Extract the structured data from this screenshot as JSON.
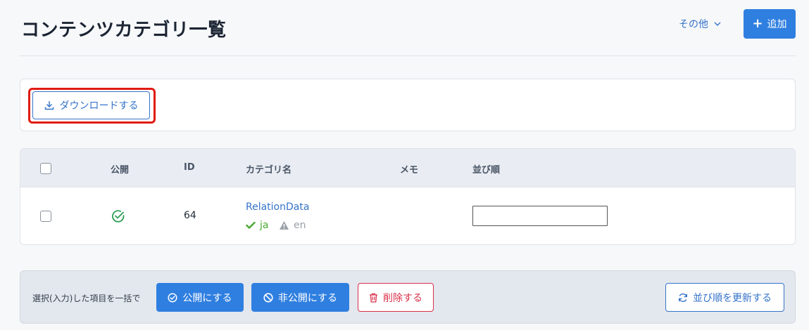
{
  "header": {
    "title": "コンテンツカテゴリ一覧",
    "other_label": "その他",
    "add_label": "追加"
  },
  "download": {
    "label": "ダウンロードする"
  },
  "table": {
    "columns": {
      "published": "公開",
      "id": "ID",
      "category_name": "カテゴリ名",
      "memo": "メモ",
      "sort_order": "並び順"
    },
    "rows": [
      {
        "published": true,
        "id": "64",
        "category_name": "RelationData",
        "languages": [
          {
            "code": "ja",
            "status": "ok"
          },
          {
            "code": "en",
            "status": "warning"
          }
        ],
        "memo": "",
        "sort_order": ""
      }
    ]
  },
  "bulk": {
    "label": "選択(入力)した項目を一括で",
    "publish_label": "公開にする",
    "unpublish_label": "非公開にする",
    "delete_label": "削除する",
    "update_sort_label": "並び順を更新する"
  },
  "colors": {
    "primary": "#2f7fe0",
    "danger": "#d9304a",
    "success": "#49a832",
    "highlight": "#e01b12"
  }
}
